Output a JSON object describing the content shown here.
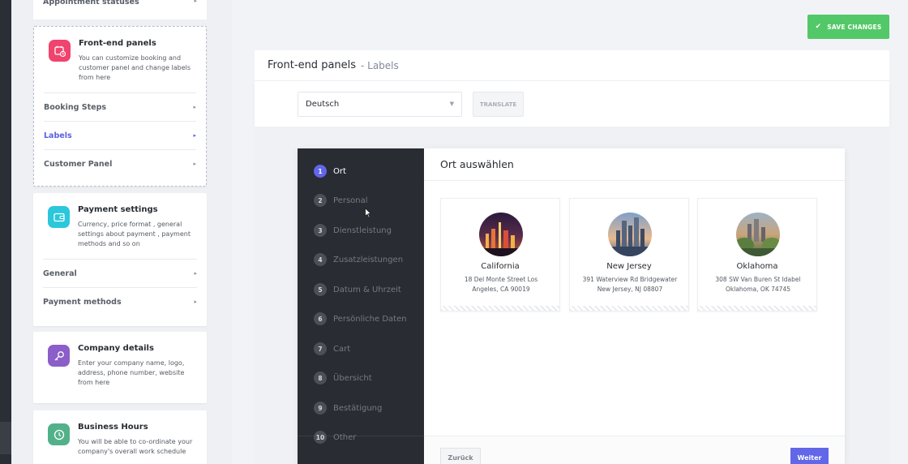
{
  "sidebar": {
    "top_item": "Appointment statuses",
    "frontend": {
      "title": "Front-end panels",
      "desc": "You can customize booking and customer panel and change labels from here",
      "items": [
        {
          "label": "Booking Steps"
        },
        {
          "label": "Labels"
        },
        {
          "label": "Customer Panel"
        }
      ]
    },
    "payment": {
      "title": "Payment settings",
      "desc": "Currency, price format , general settings about payment , payment methods and so on",
      "items": [
        {
          "label": "General"
        },
        {
          "label": "Payment methods"
        }
      ]
    },
    "company": {
      "title": "Company details",
      "desc": "Enter your company name, logo, address, phone number, website from here"
    },
    "hours": {
      "title": "Business Hours",
      "desc": "You will be able to co-ordinate your company's overall work schedule"
    }
  },
  "toolbar": {
    "save_label": "SAVE CHANGES"
  },
  "header": {
    "title": "Front-end panels",
    "subtitle": "- Labels"
  },
  "lang": {
    "selected": "Deutsch",
    "translate_label": "TRANSLATE"
  },
  "preview": {
    "steps": [
      {
        "num": "1",
        "label": "Ort"
      },
      {
        "num": "2",
        "label": "Personal"
      },
      {
        "num": "3",
        "label": "Dienstleistung"
      },
      {
        "num": "4",
        "label": "Zusatzleistungen"
      },
      {
        "num": "5",
        "label": "Datum & Uhrzeit"
      },
      {
        "num": "6",
        "label": "Persönliche Daten"
      },
      {
        "num": "7",
        "label": "Cart"
      },
      {
        "num": "8",
        "label": "Übersicht"
      },
      {
        "num": "9",
        "label": "Bestätigung"
      },
      {
        "num": "10",
        "label": "Other"
      }
    ],
    "content_title": "Ort auswählen",
    "locations": [
      {
        "name": "California",
        "address": "18 Del Monte Street Los Angeles, CA 90019"
      },
      {
        "name": "New Jersey",
        "address": "391 Waterview Rd Bridgewater New Jersey, NJ 08807"
      },
      {
        "name": "Oklahoma",
        "address": "308 SW Van Buren St Idabel Oklahoma, OK 74745"
      }
    ],
    "back_label": "Zurück",
    "next_label": "Weiter"
  },
  "colors": {
    "accent": "#6266e8",
    "save": "#53c868",
    "steps_bg": "#292c33",
    "pink": "#f0436e",
    "cyan": "#2bc7da",
    "purple": "#8c5ec9",
    "green": "#53b18a"
  }
}
